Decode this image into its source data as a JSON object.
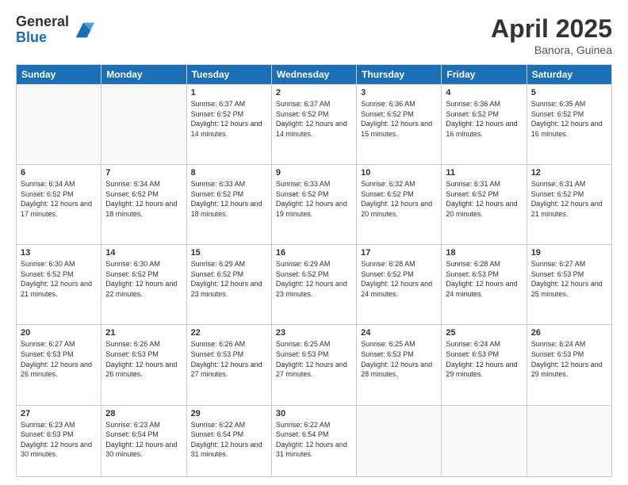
{
  "logo": {
    "general": "General",
    "blue": "Blue"
  },
  "title": "April 2025",
  "location": "Banora, Guinea",
  "days_header": [
    "Sunday",
    "Monday",
    "Tuesday",
    "Wednesday",
    "Thursday",
    "Friday",
    "Saturday"
  ],
  "weeks": [
    [
      {
        "day": "",
        "sunrise": "",
        "sunset": "",
        "daylight": ""
      },
      {
        "day": "",
        "sunrise": "",
        "sunset": "",
        "daylight": ""
      },
      {
        "day": "1",
        "sunrise": "Sunrise: 6:37 AM",
        "sunset": "Sunset: 6:52 PM",
        "daylight": "Daylight: 12 hours and 14 minutes."
      },
      {
        "day": "2",
        "sunrise": "Sunrise: 6:37 AM",
        "sunset": "Sunset: 6:52 PM",
        "daylight": "Daylight: 12 hours and 14 minutes."
      },
      {
        "day": "3",
        "sunrise": "Sunrise: 6:36 AM",
        "sunset": "Sunset: 6:52 PM",
        "daylight": "Daylight: 12 hours and 15 minutes."
      },
      {
        "day": "4",
        "sunrise": "Sunrise: 6:36 AM",
        "sunset": "Sunset: 6:52 PM",
        "daylight": "Daylight: 12 hours and 16 minutes."
      },
      {
        "day": "5",
        "sunrise": "Sunrise: 6:35 AM",
        "sunset": "Sunset: 6:52 PM",
        "daylight": "Daylight: 12 hours and 16 minutes."
      }
    ],
    [
      {
        "day": "6",
        "sunrise": "Sunrise: 6:34 AM",
        "sunset": "Sunset: 6:52 PM",
        "daylight": "Daylight: 12 hours and 17 minutes."
      },
      {
        "day": "7",
        "sunrise": "Sunrise: 6:34 AM",
        "sunset": "Sunset: 6:52 PM",
        "daylight": "Daylight: 12 hours and 18 minutes."
      },
      {
        "day": "8",
        "sunrise": "Sunrise: 6:33 AM",
        "sunset": "Sunset: 6:52 PM",
        "daylight": "Daylight: 12 hours and 18 minutes."
      },
      {
        "day": "9",
        "sunrise": "Sunrise: 6:33 AM",
        "sunset": "Sunset: 6:52 PM",
        "daylight": "Daylight: 12 hours and 19 minutes."
      },
      {
        "day": "10",
        "sunrise": "Sunrise: 6:32 AM",
        "sunset": "Sunset: 6:52 PM",
        "daylight": "Daylight: 12 hours and 20 minutes."
      },
      {
        "day": "11",
        "sunrise": "Sunrise: 6:31 AM",
        "sunset": "Sunset: 6:52 PM",
        "daylight": "Daylight: 12 hours and 20 minutes."
      },
      {
        "day": "12",
        "sunrise": "Sunrise: 6:31 AM",
        "sunset": "Sunset: 6:52 PM",
        "daylight": "Daylight: 12 hours and 21 minutes."
      }
    ],
    [
      {
        "day": "13",
        "sunrise": "Sunrise: 6:30 AM",
        "sunset": "Sunset: 6:52 PM",
        "daylight": "Daylight: 12 hours and 21 minutes."
      },
      {
        "day": "14",
        "sunrise": "Sunrise: 6:30 AM",
        "sunset": "Sunset: 6:52 PM",
        "daylight": "Daylight: 12 hours and 22 minutes."
      },
      {
        "day": "15",
        "sunrise": "Sunrise: 6:29 AM",
        "sunset": "Sunset: 6:52 PM",
        "daylight": "Daylight: 12 hours and 23 minutes."
      },
      {
        "day": "16",
        "sunrise": "Sunrise: 6:29 AM",
        "sunset": "Sunset: 6:52 PM",
        "daylight": "Daylight: 12 hours and 23 minutes."
      },
      {
        "day": "17",
        "sunrise": "Sunrise: 6:28 AM",
        "sunset": "Sunset: 6:52 PM",
        "daylight": "Daylight: 12 hours and 24 minutes."
      },
      {
        "day": "18",
        "sunrise": "Sunrise: 6:28 AM",
        "sunset": "Sunset: 6:53 PM",
        "daylight": "Daylight: 12 hours and 24 minutes."
      },
      {
        "day": "19",
        "sunrise": "Sunrise: 6:27 AM",
        "sunset": "Sunset: 6:53 PM",
        "daylight": "Daylight: 12 hours and 25 minutes."
      }
    ],
    [
      {
        "day": "20",
        "sunrise": "Sunrise: 6:27 AM",
        "sunset": "Sunset: 6:53 PM",
        "daylight": "Daylight: 12 hours and 26 minutes."
      },
      {
        "day": "21",
        "sunrise": "Sunrise: 6:26 AM",
        "sunset": "Sunset: 6:53 PM",
        "daylight": "Daylight: 12 hours and 26 minutes."
      },
      {
        "day": "22",
        "sunrise": "Sunrise: 6:26 AM",
        "sunset": "Sunset: 6:53 PM",
        "daylight": "Daylight: 12 hours and 27 minutes."
      },
      {
        "day": "23",
        "sunrise": "Sunrise: 6:25 AM",
        "sunset": "Sunset: 6:53 PM",
        "daylight": "Daylight: 12 hours and 27 minutes."
      },
      {
        "day": "24",
        "sunrise": "Sunrise: 6:25 AM",
        "sunset": "Sunset: 6:53 PM",
        "daylight": "Daylight: 12 hours and 28 minutes."
      },
      {
        "day": "25",
        "sunrise": "Sunrise: 6:24 AM",
        "sunset": "Sunset: 6:53 PM",
        "daylight": "Daylight: 12 hours and 29 minutes."
      },
      {
        "day": "26",
        "sunrise": "Sunrise: 6:24 AM",
        "sunset": "Sunset: 6:53 PM",
        "daylight": "Daylight: 12 hours and 29 minutes."
      }
    ],
    [
      {
        "day": "27",
        "sunrise": "Sunrise: 6:23 AM",
        "sunset": "Sunset: 6:53 PM",
        "daylight": "Daylight: 12 hours and 30 minutes."
      },
      {
        "day": "28",
        "sunrise": "Sunrise: 6:23 AM",
        "sunset": "Sunset: 6:54 PM",
        "daylight": "Daylight: 12 hours and 30 minutes."
      },
      {
        "day": "29",
        "sunrise": "Sunrise: 6:22 AM",
        "sunset": "Sunset: 6:54 PM",
        "daylight": "Daylight: 12 hours and 31 minutes."
      },
      {
        "day": "30",
        "sunrise": "Sunrise: 6:22 AM",
        "sunset": "Sunset: 6:54 PM",
        "daylight": "Daylight: 12 hours and 31 minutes."
      },
      {
        "day": "",
        "sunrise": "",
        "sunset": "",
        "daylight": ""
      },
      {
        "day": "",
        "sunrise": "",
        "sunset": "",
        "daylight": ""
      },
      {
        "day": "",
        "sunrise": "",
        "sunset": "",
        "daylight": ""
      }
    ]
  ]
}
